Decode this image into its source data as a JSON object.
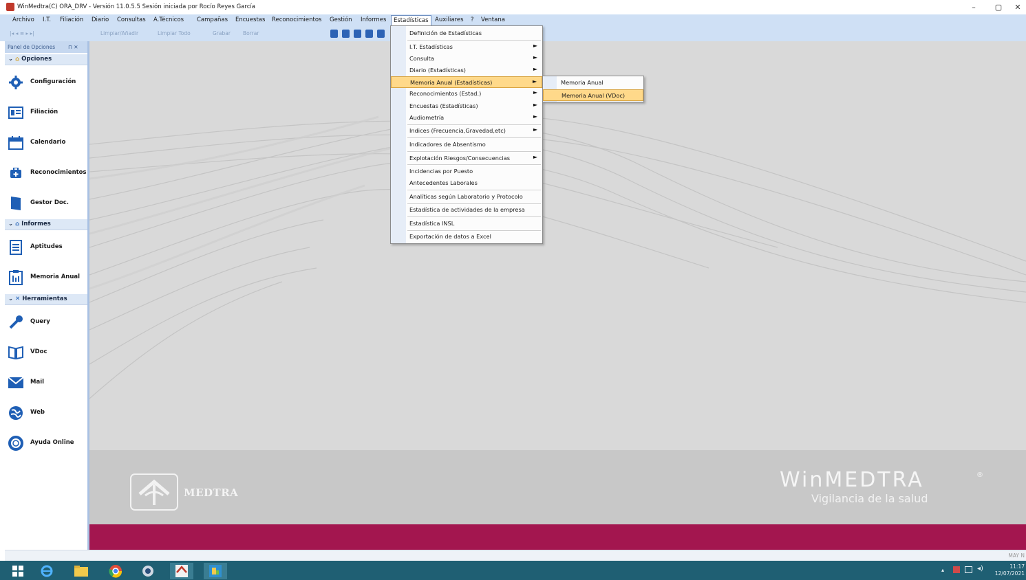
{
  "window": {
    "title": "WinMedtra(C) ORA_DRV - Versión 11.0.5.5 Sesión iniciada por Rocío Reyes García",
    "minimize": "–",
    "maximize": "▢",
    "close": "✕"
  },
  "menubar": {
    "items": [
      "Archivo",
      "I.T.",
      "Filiación",
      "Diario",
      "Consultas",
      "A.Técnicos",
      "Campañas",
      "Encuestas",
      "Reconocimientos",
      "Gestión",
      "Informes",
      "Estadísticas",
      "Auxiliares",
      "?",
      "Ventana"
    ],
    "active": "Estadísticas"
  },
  "toolbar": {
    "limpiar_anadir": "Limpiar/Añadir",
    "limpiar_todo": "Limpiar Todo",
    "grabar": "Grabar",
    "borrar": "Borrar"
  },
  "sidepanel": {
    "header": "Panel de Opciones",
    "pin": "⊓ ✕",
    "groups": {
      "opciones": "Opciones",
      "informes": "Informes",
      "herramientas": "Herramientas"
    },
    "options": {
      "configuracion": "Configuración",
      "filiacion": "Filiación",
      "calendario": "Calendario",
      "reconocimientos": "Reconocimientos",
      "gestor_doc": "Gestor Doc.",
      "aptitudes": "Aptitudes",
      "memoria_anual": "Memoria Anual",
      "query": "Query",
      "vdoc": "VDoc",
      "mail": "Mail",
      "web": "Web",
      "ayuda_online": "Ayuda Online"
    }
  },
  "dropdown": {
    "items": [
      {
        "label": "Definición de Estadísticas",
        "arrow": ""
      },
      {
        "label": "I.T. Estadísticas",
        "arrow": "►"
      },
      {
        "label": "Consulta",
        "arrow": "►"
      },
      {
        "label": "Diario (Estadísticas)",
        "arrow": "►"
      },
      {
        "label": "Memoria Anual (Estadísticas)",
        "arrow": "►"
      },
      {
        "label": "Reconocimientos (Estad.)",
        "arrow": "►"
      },
      {
        "label": "Encuestas (Estadísticas)",
        "arrow": "►"
      },
      {
        "label": "Audiometría",
        "arrow": "►"
      },
      {
        "label": "Indices (Frecuencia,Gravedad,etc)",
        "arrow": "►"
      },
      {
        "label": "Indicadores de Absentismo",
        "arrow": ""
      },
      {
        "label": "Explotación Riesgos/Consecuencias",
        "arrow": "►"
      },
      {
        "label": "Incidencias por Puesto",
        "arrow": ""
      },
      {
        "label": "Antecedentes Laborales",
        "arrow": ""
      },
      {
        "label": "Analíticas según Laboratorio y Protocolo",
        "arrow": ""
      },
      {
        "label": "Estadística de actividades de la empresa",
        "arrow": ""
      },
      {
        "label": "Estadística INSL",
        "arrow": ""
      },
      {
        "label": "Exportación de datos a Excel",
        "arrow": ""
      }
    ],
    "highlighted": "Memoria Anual (Estadísticas)"
  },
  "submenu": {
    "items": [
      "Memoria Anual",
      "Memoria Anual (VDoc)"
    ],
    "highlighted": "Memoria Anual (VDoc)"
  },
  "branding": {
    "medtra": "MEDTRA",
    "product": "WinMEDTRA",
    "registered": "®",
    "tagline": "Vigilancia de la salud"
  },
  "statusbar": {
    "text": "MAY  N"
  },
  "taskbar": {
    "time": "11:17",
    "date": "12/07/2021"
  },
  "colors": {
    "accent_band": "#a3164f",
    "menu_highlight": "#ffd98a",
    "menubar": "#cfe0f5",
    "taskbar": "#1f5f73"
  }
}
